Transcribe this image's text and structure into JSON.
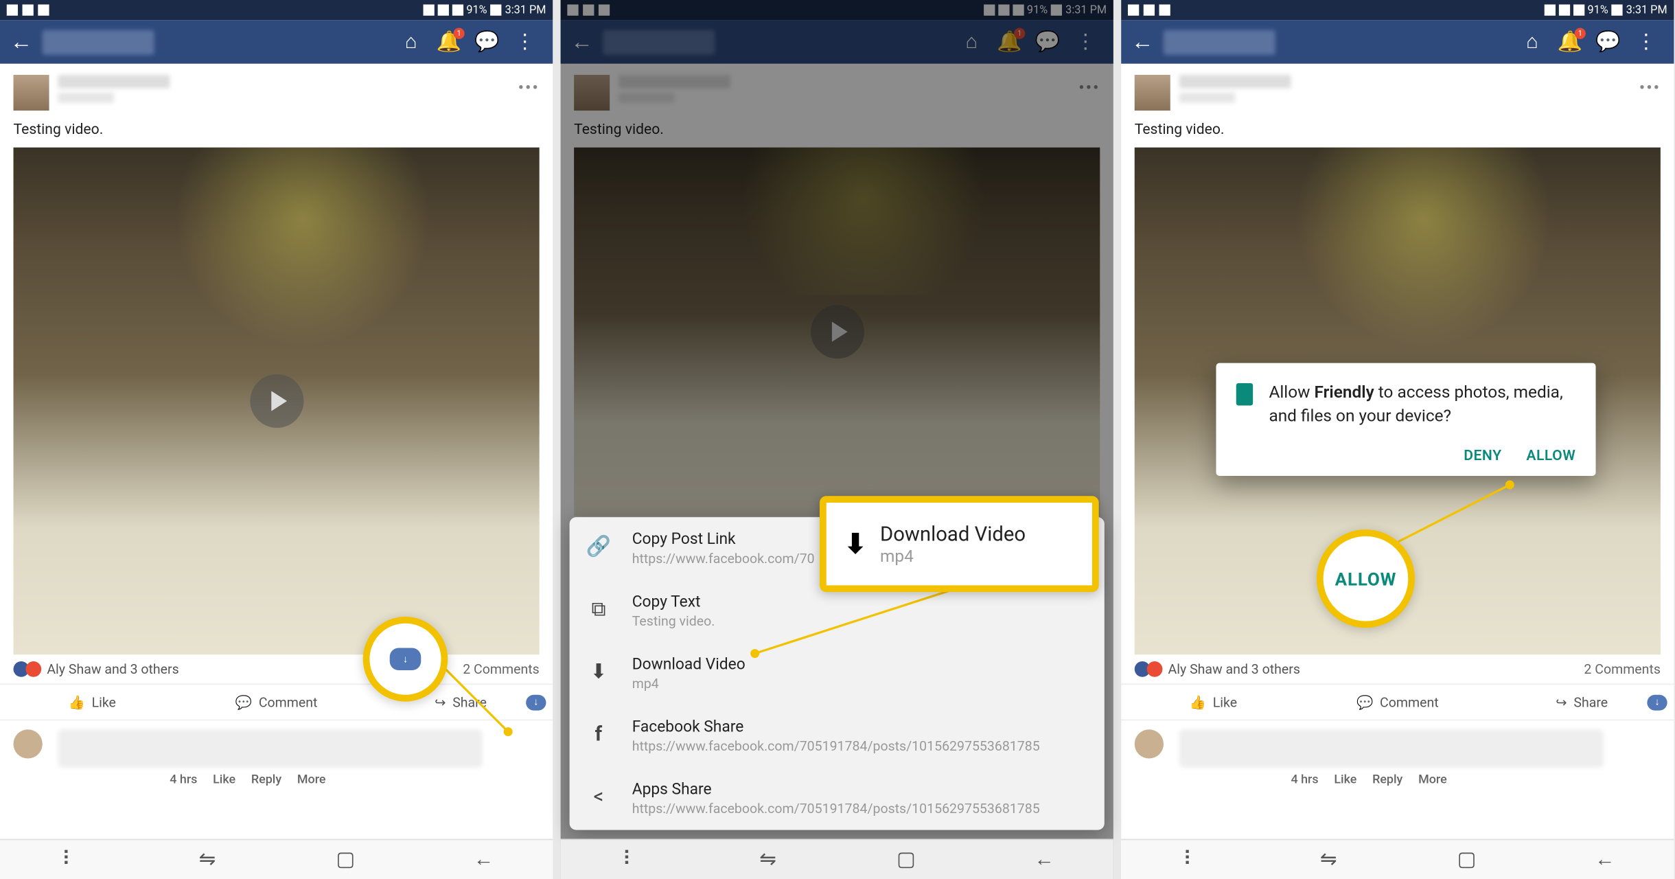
{
  "status": {
    "battery": "91%",
    "time": "3:31 PM"
  },
  "appbar": {
    "badge": "1"
  },
  "post": {
    "text": "Testing video.",
    "reactions_text": "Aly Shaw and 3 others",
    "comments_count": "2 Comments"
  },
  "actions": {
    "like": "Like",
    "comment": "Comment",
    "share": "Share"
  },
  "comment": {
    "meta_time": "4 hrs",
    "meta_like": "Like",
    "meta_reply": "Reply",
    "meta_more": "More"
  },
  "sheet": {
    "copy_link": {
      "title": "Copy Post Link",
      "sub": "https://www.facebook.com/70"
    },
    "copy_text": {
      "title": "Copy Text",
      "sub": "Testing video."
    },
    "download": {
      "title": "Download Video",
      "sub": "mp4"
    },
    "fb_share": {
      "title": "Facebook Share",
      "sub": "https://www.facebook.com/705191784/posts/10156297553681785"
    },
    "apps_share": {
      "title": "Apps Share",
      "sub": "https://www.facebook.com/705191784/posts/10156297553681785"
    }
  },
  "callout": {
    "download_title": "Download Video",
    "download_sub": "mp4",
    "allow": "ALLOW"
  },
  "perm": {
    "text_pre": "Allow ",
    "app": "Friendly",
    "text_post": " to access photos, media, and files on your device?",
    "deny": "DENY",
    "allow": "ALLOW"
  }
}
